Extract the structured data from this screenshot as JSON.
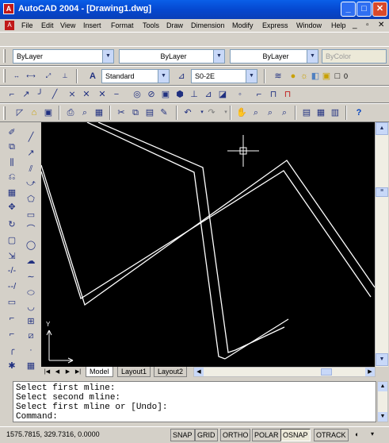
{
  "window": {
    "title": "AutoCAD 2004 - [Drawing1.dwg]",
    "app_icon": "A",
    "minimize": "_",
    "maximize": "□",
    "close": "✕"
  },
  "menu": {
    "items": [
      "File",
      "Edit",
      "View",
      "Insert",
      "Format",
      "Tools",
      "Draw",
      "Dimension",
      "Modify",
      "Express",
      "Window",
      "Help"
    ],
    "doc_minimize": "_",
    "doc_restore": "▫",
    "doc_close": "✕"
  },
  "layers_toolbar": {
    "layer_combo": "ByLayer",
    "color_combo": "ByLayer",
    "linetype_combo": "ByLayer",
    "plotstyle_combo": "ByColor"
  },
  "styles_toolbar": {
    "text_style": "Standard",
    "dim_style": "S0-2E",
    "layer_current": "0"
  },
  "layout_tabs": [
    "Model",
    "Layout1",
    "Layout2"
  ],
  "command_window": {
    "lines": [
      "Select first mline:",
      "Select second mline:",
      "Select first mline or [Undo]:",
      "Command:"
    ]
  },
  "status_bar": {
    "coordinates": "1575.7815, 329.7316, 0.0000",
    "toggles": [
      {
        "label": "SNAP",
        "on": false
      },
      {
        "label": "GRID",
        "on": false
      },
      {
        "label": "ORTHO",
        "on": false
      },
      {
        "label": "POLAR",
        "on": false
      },
      {
        "label": "OSNAP",
        "on": true
      },
      {
        "label": "OTRACK",
        "on": false
      }
    ]
  },
  "drawing": {
    "background": "#000000",
    "line_color": "#ffffff",
    "ucs_y_label": "Y"
  },
  "icons": {
    "draw_tools": [
      "line-icon",
      "construction-line-icon",
      "multiline-icon",
      "polyline-icon",
      "polygon-icon",
      "rectangle-icon",
      "arc-icon",
      "circle-icon",
      "revision-cloud-icon",
      "spline-icon",
      "ellipse-icon",
      "ellipse-arc-icon",
      "insert-block-icon",
      "make-block-icon",
      "point-icon",
      "hatch-icon",
      "region-icon",
      "table-icon",
      "mtext-icon"
    ],
    "modify_tools": [
      "erase-icon",
      "copy-icon",
      "mirror-icon",
      "offset-icon",
      "array-icon",
      "move-icon",
      "rotate-icon",
      "scale-icon",
      "stretch-icon",
      "trim-icon",
      "extend-icon",
      "break-at-point-icon",
      "break-icon",
      "chamfer-icon",
      "fillet-icon",
      "explode-icon"
    ]
  }
}
